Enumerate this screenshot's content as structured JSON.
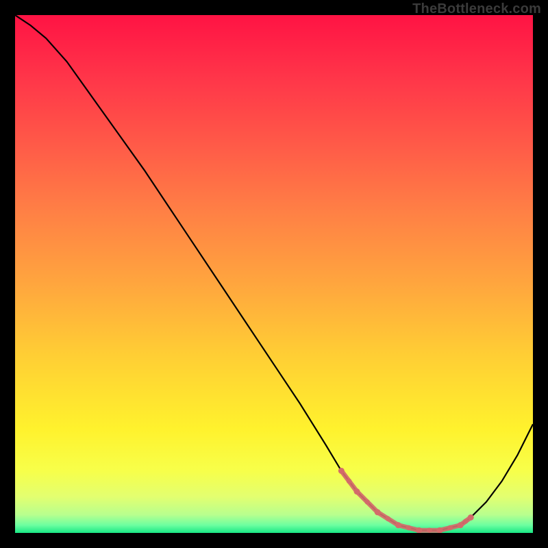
{
  "watermark": "TheBottleneck.com",
  "chart_data": {
    "type": "line",
    "title": "",
    "xlabel": "",
    "ylabel": "",
    "xlim": [
      0,
      100
    ],
    "ylim": [
      0,
      100
    ],
    "grid": false,
    "legend": false,
    "series": [
      {
        "name": "curve",
        "x": [
          0,
          3,
          6,
          10,
          15,
          20,
          25,
          30,
          35,
          40,
          45,
          50,
          55,
          60,
          63,
          66,
          70,
          74,
          78,
          82,
          86,
          88,
          91,
          94,
          97,
          100
        ],
        "values": [
          100,
          98,
          95.5,
          91,
          84,
          77,
          70,
          62.5,
          55,
          47.5,
          40,
          32.5,
          25,
          17,
          12,
          8,
          4,
          1.5,
          0.5,
          0.5,
          1.5,
          3,
          6,
          10,
          15,
          21
        ],
        "color": "#000000"
      },
      {
        "name": "bottom-highlight",
        "x": [
          63,
          66,
          70,
          74,
          78,
          82,
          86,
          88
        ],
        "values": [
          12,
          8,
          4,
          1.5,
          0.5,
          0.5,
          1.5,
          3
        ],
        "color": "#d36a6a"
      }
    ],
    "gradient_stops": [
      {
        "offset": 0.0,
        "color": "#ff1344"
      },
      {
        "offset": 0.12,
        "color": "#ff3549"
      },
      {
        "offset": 0.25,
        "color": "#ff5a48"
      },
      {
        "offset": 0.38,
        "color": "#ff8045"
      },
      {
        "offset": 0.52,
        "color": "#ffa63e"
      },
      {
        "offset": 0.66,
        "color": "#ffcf34"
      },
      {
        "offset": 0.8,
        "color": "#fff22d"
      },
      {
        "offset": 0.88,
        "color": "#f7ff4a"
      },
      {
        "offset": 0.93,
        "color": "#e3ff70"
      },
      {
        "offset": 0.965,
        "color": "#b8ff8e"
      },
      {
        "offset": 0.985,
        "color": "#6cffa0"
      },
      {
        "offset": 1.0,
        "color": "#18e884"
      }
    ]
  }
}
